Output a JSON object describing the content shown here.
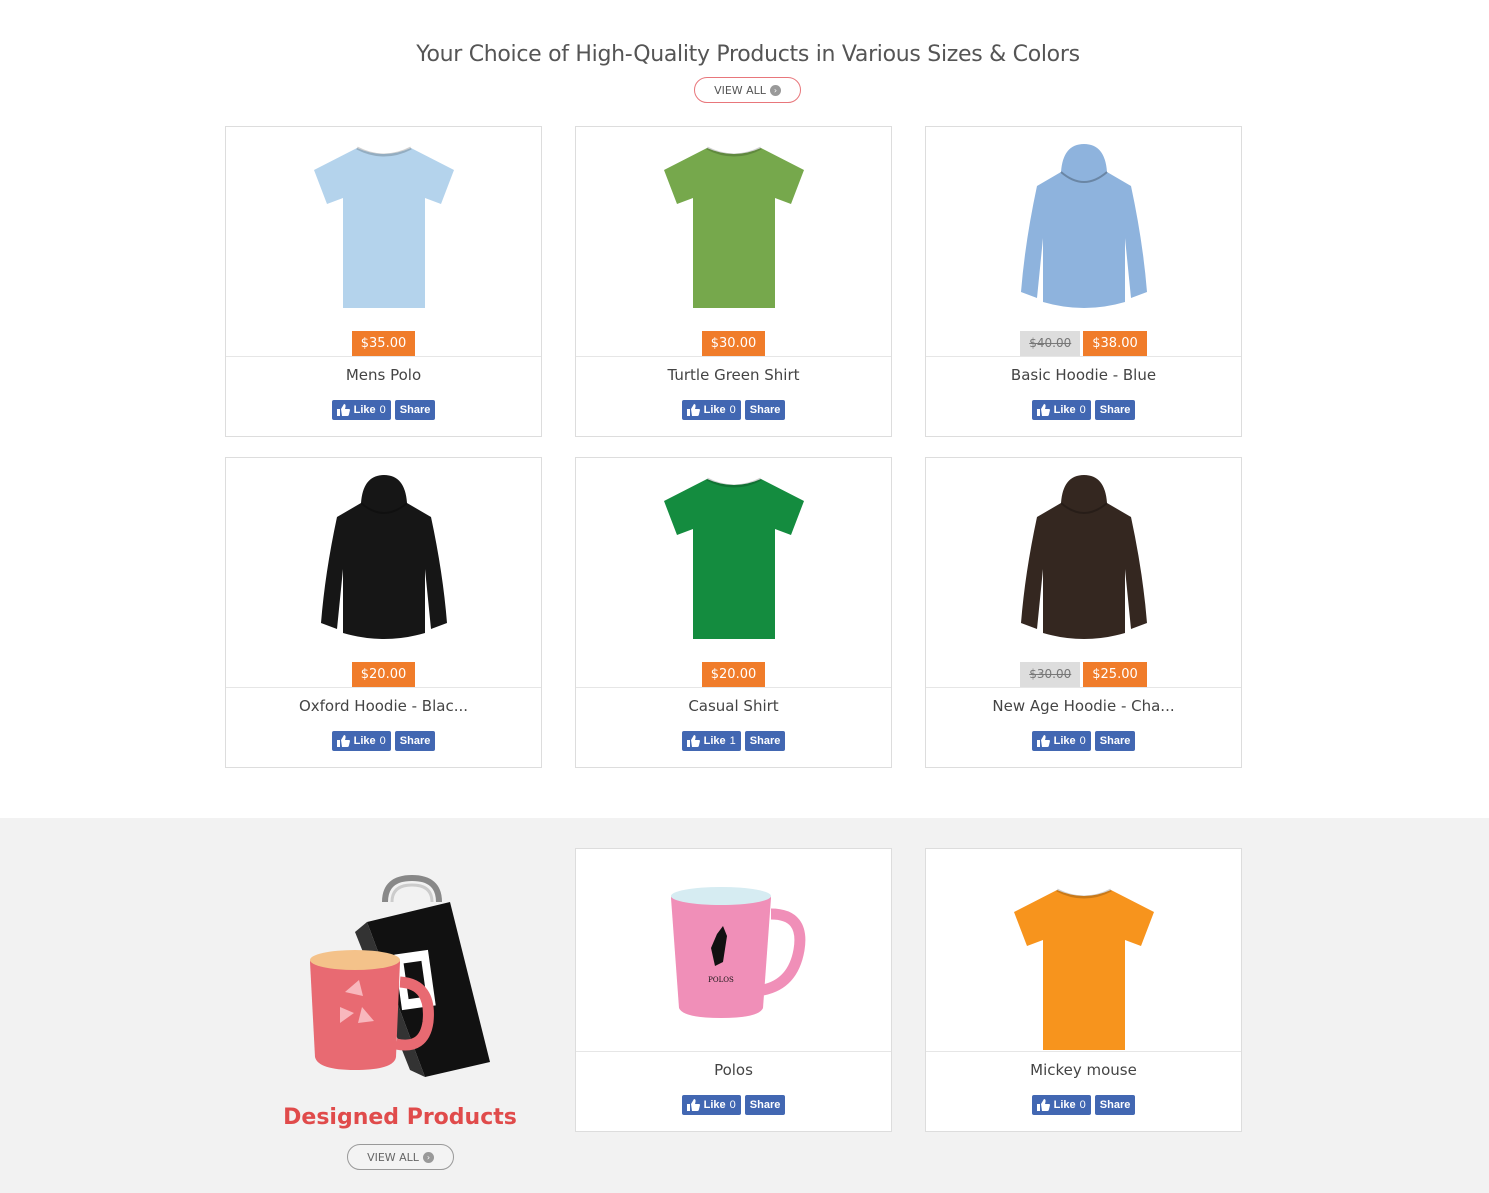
{
  "header": {
    "title": "Your Choice of High-Quality Products in Various Sizes & Colors",
    "view_all": "VIEW ALL"
  },
  "products": [
    {
      "name": "Mens Polo",
      "price": "$35.00",
      "old_price": "",
      "like": "Like",
      "like_count": "0",
      "share": "Share",
      "color": "#b4d3ec",
      "kind": "tshirt"
    },
    {
      "name": "Turtle Green Shirt",
      "price": "$30.00",
      "old_price": "",
      "like": "Like",
      "like_count": "0",
      "share": "Share",
      "color": "#76a84c",
      "kind": "tshirt"
    },
    {
      "name": "Basic Hoodie - Blue",
      "price": "$38.00",
      "old_price": "$40.00",
      "like": "Like",
      "like_count": "0",
      "share": "Share",
      "color": "#8eb3dd",
      "kind": "hoodie"
    },
    {
      "name": "Oxford Hoodie - Blac...",
      "price": "$20.00",
      "old_price": "",
      "like": "Like",
      "like_count": "0",
      "share": "Share",
      "color": "#161616",
      "kind": "hoodie"
    },
    {
      "name": "Casual Shirt",
      "price": "$20.00",
      "old_price": "",
      "like": "Like",
      "like_count": "1",
      "share": "Share",
      "color": "#148c3f",
      "kind": "tshirt"
    },
    {
      "name": "New Age Hoodie - Cha...",
      "price": "$25.00",
      "old_price": "$30.00",
      "like": "Like",
      "like_count": "0",
      "share": "Share",
      "color": "#342720",
      "kind": "hoodie"
    }
  ],
  "designed": {
    "title": "Designed Products",
    "view_all": "VIEW ALL",
    "items": [
      {
        "name": "Polos",
        "like": "Like",
        "like_count": "0",
        "share": "Share",
        "kind": "mug",
        "color": "#f08fb8",
        "print_text": "POLOS"
      },
      {
        "name": "Mickey mouse",
        "like": "Like",
        "like_count": "0",
        "share": "Share",
        "kind": "tshirt",
        "color": "#f7941d"
      }
    ]
  },
  "colors": {
    "price_badge": "#f07c2a",
    "accent_red": "#e04b4b",
    "facebook": "#4267b2"
  }
}
